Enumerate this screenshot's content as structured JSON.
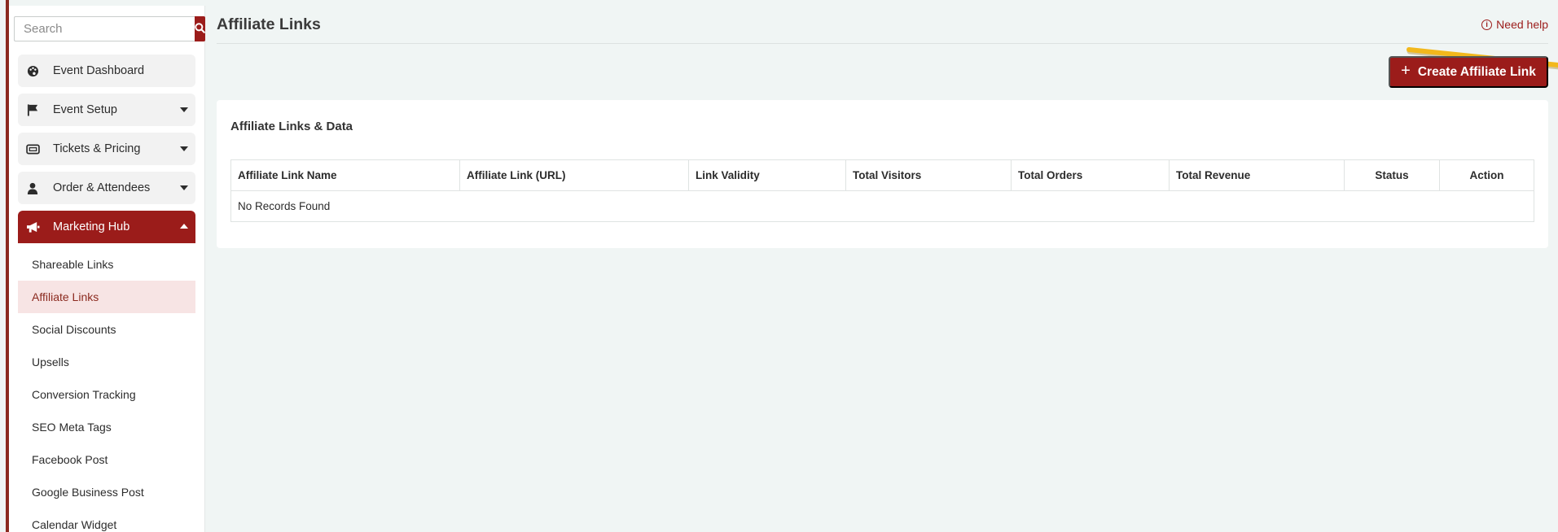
{
  "search": {
    "placeholder": "Search"
  },
  "sidebar": {
    "items": [
      {
        "label": "Event Dashboard",
        "icon": "palette-icon",
        "has_caret": false
      },
      {
        "label": "Event Setup",
        "icon": "flag-icon",
        "has_caret": true
      },
      {
        "label": "Tickets & Pricing",
        "icon": "ticket-icon",
        "has_caret": true
      },
      {
        "label": "Order & Attendees",
        "icon": "user-icon",
        "has_caret": true
      },
      {
        "label": "Marketing Hub",
        "icon": "megaphone-icon",
        "has_caret": true,
        "active": true
      }
    ],
    "submenu": [
      {
        "label": "Shareable Links"
      },
      {
        "label": "Affiliate Links",
        "selected": true
      },
      {
        "label": "Social Discounts"
      },
      {
        "label": "Upsells"
      },
      {
        "label": "Conversion Tracking"
      },
      {
        "label": "SEO Meta Tags"
      },
      {
        "label": "Facebook Post"
      },
      {
        "label": "Google Business Post"
      },
      {
        "label": "Calendar Widget"
      }
    ]
  },
  "header": {
    "title": "Affiliate Links",
    "help_label": "Need help",
    "help_icon": "info-circle-icon"
  },
  "toolbar": {
    "create_label": "Create Affiliate Link",
    "create_icon": "plus-icon"
  },
  "card": {
    "title": "Affiliate Links & Data",
    "table": {
      "columns": [
        "Affiliate Link Name",
        "Affiliate Link (URL)",
        "Link Validity",
        "Total Visitors",
        "Total Orders",
        "Total Revenue",
        "Status",
        "Action"
      ],
      "empty_message": "No Records Found"
    }
  },
  "colors": {
    "brand": "#9b1c1a",
    "selected_bg": "#f7e4e4",
    "page_bg": "#f0f5f4",
    "annotation_arrow": "#f2b81c"
  }
}
